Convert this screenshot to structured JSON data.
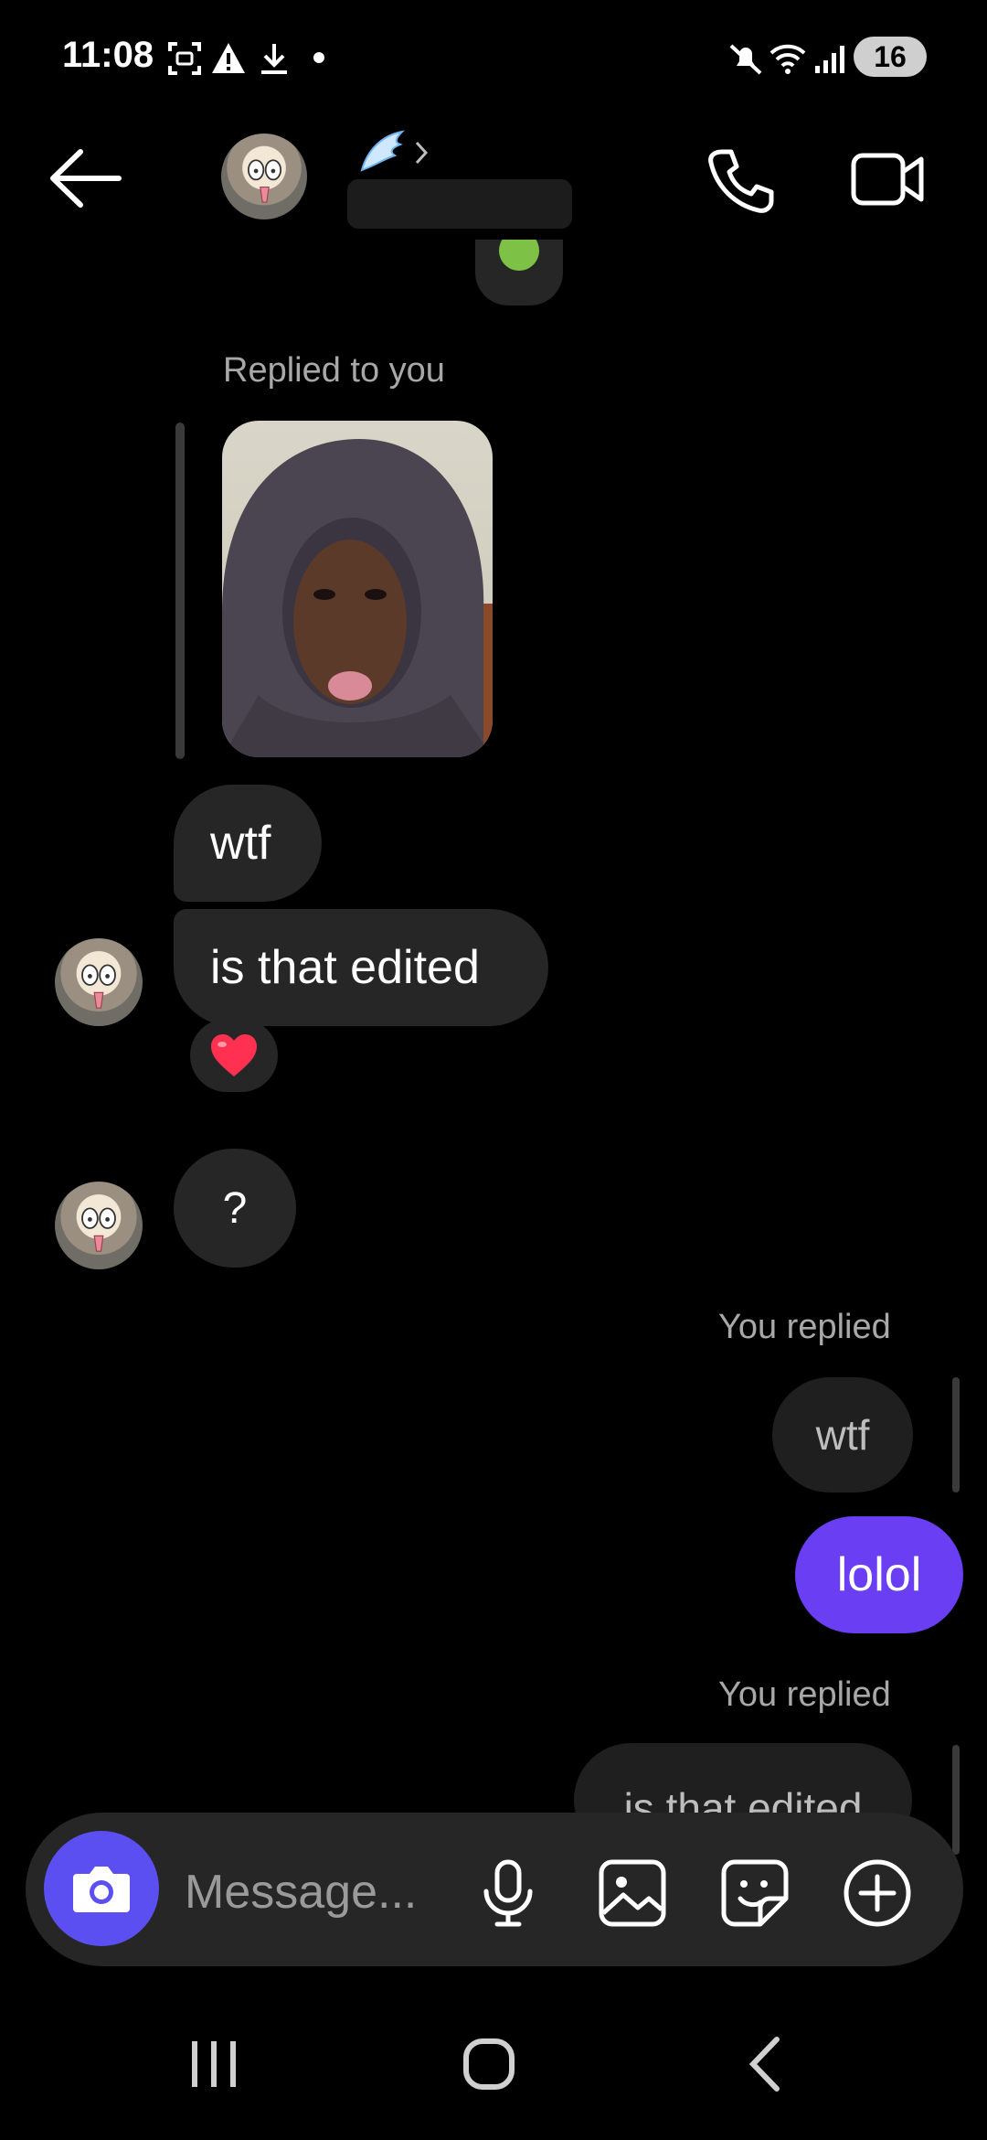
{
  "status_bar": {
    "time": "11:08",
    "battery": "16",
    "icons": [
      "screenshot-icon",
      "alert-icon",
      "download-icon",
      "dot-icon",
      "mute-icon",
      "wifi-icon",
      "signal-icon"
    ]
  },
  "header": {
    "back_icon": "arrow-left-icon",
    "name_emoji_icon": "wing-icon",
    "call_icon": "phone-icon",
    "video_icon": "video-camera-icon"
  },
  "messages": {
    "replied_to_you": "Replied to you",
    "incoming": [
      {
        "text": "wtf"
      },
      {
        "text": "is that edited"
      },
      {
        "text": "?"
      }
    ],
    "you_replied_1": "You replied",
    "quoted_1": "wtf",
    "outgoing_1": "lolol",
    "you_replied_2": "You replied",
    "quoted_2": "is that edited"
  },
  "composer": {
    "placeholder": "Message...",
    "icons": [
      "camera-icon",
      "microphone-icon",
      "gallery-icon",
      "sticker-icon",
      "plus-circle-icon"
    ]
  },
  "colors": {
    "outgoing_bubble": "#6a3ef2",
    "camera_button": "#5b4ff1",
    "incoming_bubble": "#262626",
    "background": "#000000"
  }
}
